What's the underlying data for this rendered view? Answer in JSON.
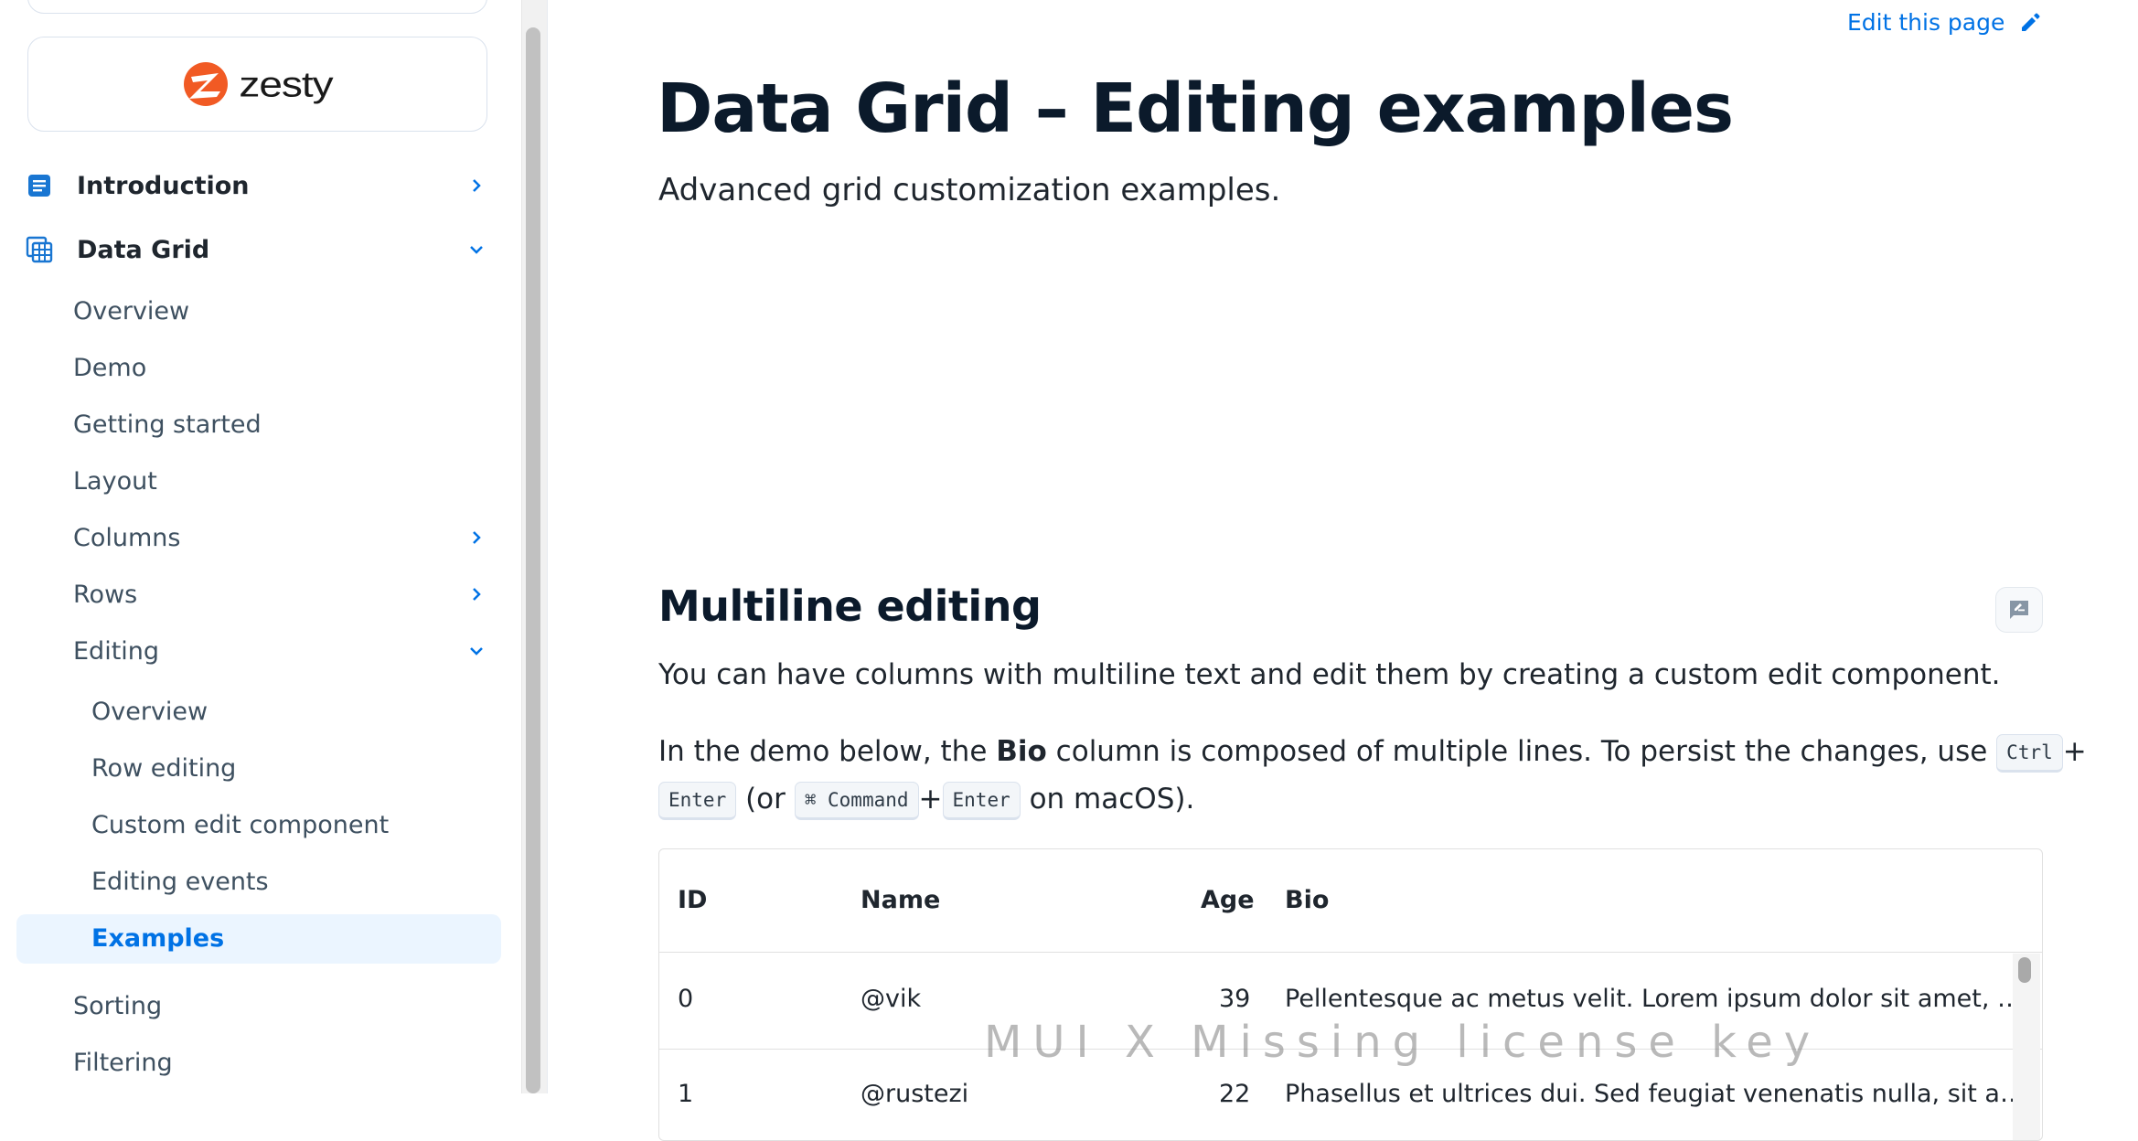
{
  "sidebar": {
    "brand": "zesty",
    "nav_top": [
      {
        "label": "Introduction",
        "icon": "article-icon",
        "expanded": false
      },
      {
        "label": "Data Grid",
        "icon": "data-grid-icon",
        "expanded": true
      }
    ],
    "data_grid_items": [
      {
        "label": "Overview"
      },
      {
        "label": "Demo"
      },
      {
        "label": "Getting started"
      },
      {
        "label": "Layout"
      },
      {
        "label": "Columns",
        "has_children": true
      },
      {
        "label": "Rows",
        "has_children": true
      },
      {
        "label": "Editing",
        "expanded": true
      },
      {
        "label": "Sorting"
      },
      {
        "label": "Filtering"
      }
    ],
    "editing_items": [
      {
        "label": "Overview"
      },
      {
        "label": "Row editing"
      },
      {
        "label": "Custom edit component"
      },
      {
        "label": "Editing events"
      },
      {
        "label": "Examples",
        "active": true
      }
    ]
  },
  "header": {
    "edit_link": "Edit this page",
    "title": "Data Grid – Editing examples",
    "subtitle": "Advanced grid customization examples."
  },
  "section": {
    "title": "Multiline editing",
    "para1": "You can have columns with multiline text and edit them by creating a custom edit component.",
    "para2_a": "In the demo below, the ",
    "para2_bold": "Bio",
    "para2_b": " column is composed of multiple lines. To persist the changes, use ",
    "kbd_ctrl": "Ctrl",
    "plus": "+",
    "kbd_enter": "Enter",
    "para3_or": " (or ",
    "kbd_command": "⌘ Command",
    "para3_end": " on macOS)."
  },
  "grid": {
    "columns": [
      "ID",
      "Name",
      "Age",
      "Bio"
    ],
    "rows": [
      {
        "id": "0",
        "name": "@vik",
        "age": "39",
        "bio": "Pellentesque ac metus velit. Lorem ipsum dolor sit amet, …"
      },
      {
        "id": "1",
        "name": "@rustezi",
        "age": "22",
        "bio": "Phasellus et ultrices dui. Sed feugiat venenatis nulla, sit a…"
      }
    ],
    "watermark": "MUI X Missing license key"
  },
  "colors": {
    "accent": "#0072e5",
    "active_bg": "#ebf5ff",
    "heading": "#0b1a2b",
    "logo_orange": "#f15a24"
  }
}
